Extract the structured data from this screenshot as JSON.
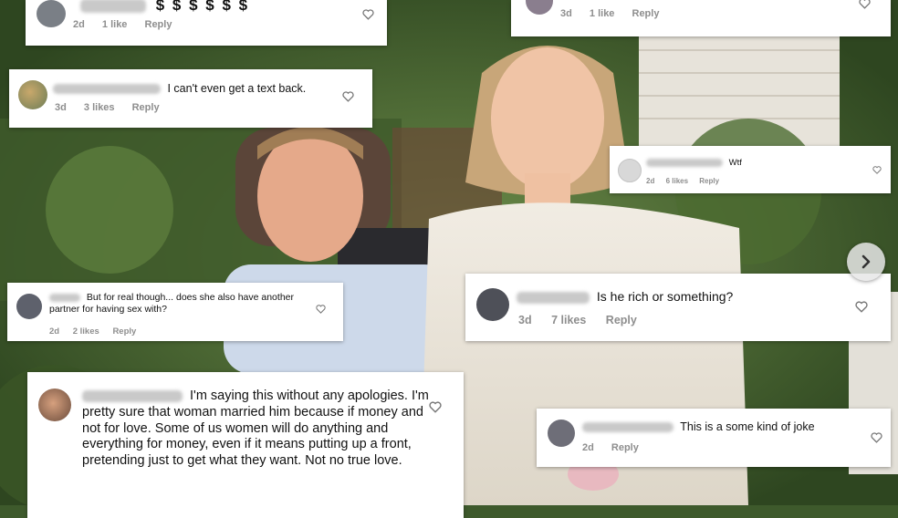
{
  "comments": [
    {
      "id": "c1",
      "text": "$ $ $ $ $ $",
      "age": "2d",
      "likes": "1 like",
      "reply": "Reply"
    },
    {
      "id": "c2",
      "text": "",
      "age": "3d",
      "likes": "1 like",
      "reply": "Reply"
    },
    {
      "id": "c3",
      "text": "I can't even get a text back.",
      "age": "3d",
      "likes": "3 likes",
      "reply": "Reply"
    },
    {
      "id": "c4",
      "text": "Wtf",
      "age": "2d",
      "likes": "6 likes",
      "reply": "Reply"
    },
    {
      "id": "c5",
      "text": "But for real though... does she also have another partner for having sex with?",
      "age": "2d",
      "likes": "2 likes",
      "reply": "Reply"
    },
    {
      "id": "c6",
      "text": "Is he rich or something?",
      "age": "3d",
      "likes": "7 likes",
      "reply": "Reply"
    },
    {
      "id": "c7",
      "text": "I'm saying this without any apologies. I'm pretty sure that woman married him because if money and not for love. Some of us women will do anything and everything for money, even if it means putting up a front, pretending just to get what they want. Not no true love.",
      "age": "",
      "likes": "",
      "reply": ""
    },
    {
      "id": "c8",
      "text": "This is a some kind of joke",
      "age": "2d",
      "likes": "",
      "reply": "Reply"
    }
  ],
  "icons": {
    "like": "heart-outline-icon",
    "next": "chevron-right-icon"
  },
  "colors": {
    "meta_text": "#8e8e8e",
    "card_bg": "#ffffff",
    "blurred_username": "#c9c9c9"
  }
}
